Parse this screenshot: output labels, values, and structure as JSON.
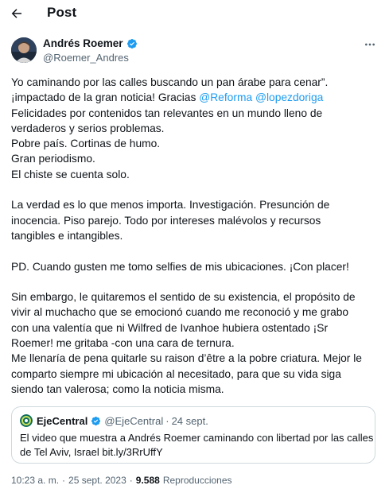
{
  "header": {
    "title": "Post"
  },
  "author": {
    "name": "Andrés Roemer",
    "handle": "@Roemer_Andres"
  },
  "tweet": {
    "line1": "Yo caminando por las calles buscando un pan árabe para cenar”.",
    "line2_prefix": "¡impactado de la gran noticia! Gracias ",
    "mention1": "@Reforma",
    "mention2": "@lopezdoriga",
    "line3": "Felicidades por contenidos tan relevantes en un mundo lleno de",
    "line4": "verdaderos y serios problemas.",
    "line5": "Pobre país. Cortinas de humo.",
    "line6": "Gran periodismo.",
    "line7": "El chiste se cuenta solo.",
    "line8": "La verdad es lo que menos importa. Investigación. Presunción de",
    "line9": "inocencia. Piso parejo. Todo por intereses malévolos y recursos",
    "line10": "tangibles e intangibles.",
    "line11": "PD. Cuando gusten me tomo selfies de mis ubicaciones. ¡Con placer!",
    "line12": "Sin embargo,  le quitaremos el sentido de su existencia, el propósito de",
    "line13": "vivir al muchacho que se emocionó cuando me reconoció y me grabo",
    "line14": "con una valentía que ni Wilfred de Ivanhoe hubiera ostentado ¡Sr",
    "line15": "Roemer! me gritaba -con una cara de ternura.",
    "line16": "Me llenaría de pena quitarle su raison d’être a la pobre criatura. Mejor le",
    "line17": "comparto siempre mi ubicación al necesitado, para que su vida siga",
    "line18": "siendo tan valerosa; como la noticia misma."
  },
  "quote": {
    "name": "EjeCentral",
    "handle": "@EjeCentral",
    "separator": "·",
    "time": "24 sept.",
    "line1": "El video que muestra a Andrés Roemer caminando con libertad por las calles",
    "line2": "de Tel Aviv, Israel bit.ly/3RrUffY"
  },
  "meta": {
    "time": "10:23 a. m.",
    "dot1": "·",
    "date": "25 sept. 2023",
    "dot2": "·",
    "views": "9.588",
    "views_label": "Reproducciones"
  },
  "colors": {
    "accent": "#1d9bf0",
    "text": "#0f1419",
    "muted": "#536471",
    "border": "#cfd9de"
  }
}
